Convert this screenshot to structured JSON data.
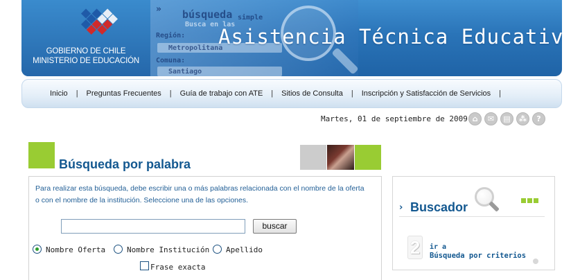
{
  "header": {
    "gov_line1": "GOBIERNO DE CHILE",
    "gov_line2": "MINISTERIO DE EDUCACIÓN",
    "title": "Asistencia Técnica Educativa",
    "screenshot_text": {
      "search": "búsqueda",
      "simple": "simple",
      "busca": "Busca en las",
      "region_label": "Región:",
      "region_value": "Metropolitana",
      "comuna_label": "Comuna:",
      "comuna_value": "Santiago"
    }
  },
  "nav": {
    "items": [
      {
        "label": "Inicio"
      },
      {
        "label": "Preguntas Frecuentes"
      },
      {
        "label": "Guía de trabajo con ATE"
      },
      {
        "label": "Sitios de Consulta"
      },
      {
        "label": "Inscripción y Satisfacción de Servicios"
      }
    ],
    "separator": "|"
  },
  "date": "Martes, 01 de septiembre de 2009",
  "tools": {
    "home": "home-icon",
    "mail": "mail-icon",
    "print": "print-icon",
    "sitemap": "sitemap-icon",
    "help": "help-icon",
    "help_glyph": "?"
  },
  "search": {
    "title": "Búsqueda por palabra",
    "instructions": "Para realizar esta búsqueda, debe escribir una o más palabras relacionada con el nombre de la oferta o con el nombre de la institución. Seleccione una de las opciones.",
    "input_value": "",
    "button_label": "buscar",
    "options": [
      {
        "label": "Nombre Oferta",
        "checked": true
      },
      {
        "label": "Nombre Institución",
        "checked": false
      },
      {
        "label": "Apellido",
        "checked": false
      }
    ],
    "exact_phrase_label": "Frase exacta",
    "exact_phrase_checked": false
  },
  "sidebar": {
    "title": "Buscador",
    "number": "2",
    "link_prefix": "ir a",
    "link_label": "Búsqueda por criterios"
  },
  "colors": {
    "brand_blue": "#135890",
    "accent_green": "#99cc33",
    "banner_blue": "#2a74b8"
  }
}
